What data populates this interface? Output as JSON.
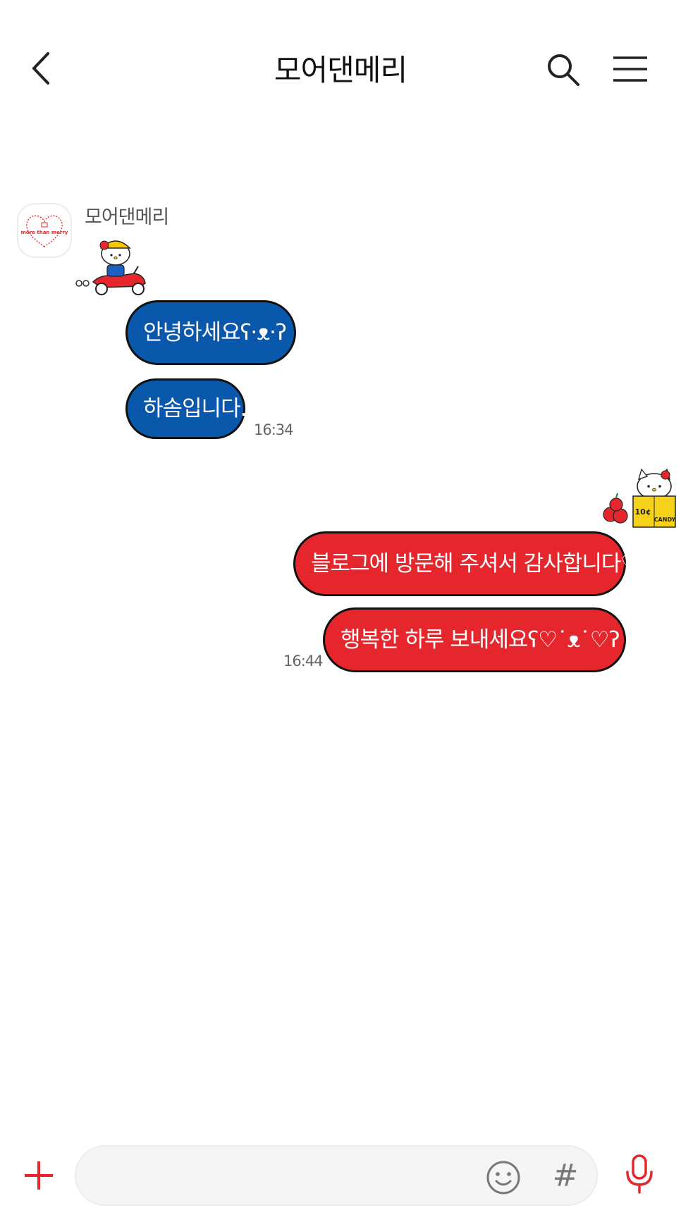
{
  "header": {
    "title": "모어댄메리",
    "back_icon": "chevron-left-icon",
    "search_icon": "search-icon",
    "menu_icon": "hamburger-menu-icon"
  },
  "messages": {
    "sender_name": "모어댄메리",
    "avatar_logo_text": "more than merry",
    "incoming": [
      {
        "text": "안녕하세요ʕ·ᴥ·ʔ"
      },
      {
        "text": "하솜입니다."
      }
    ],
    "incoming_time": "16:34",
    "outgoing": [
      {
        "text": "블로그에 방문해 주셔서 감사합니다♡"
      },
      {
        "text": "행복한 하루 보내세요ʕ♡˙ᴥ˙♡ʔ"
      }
    ],
    "outgoing_time": "16:44",
    "sticker_in": "hello-kitty-scooter-sticker",
    "sticker_out": "hello-kitty-candy-bag-sticker",
    "sticker_out_text": [
      "10¢",
      "CANDY"
    ]
  },
  "composer": {
    "placeholder": "",
    "value": "",
    "plus_icon": "plus-icon",
    "emoji_icon": "emoji-icon",
    "hashtag_label": "#",
    "mic_icon": "microphone-icon"
  },
  "colors": {
    "incoming_bubble": "#0a58ac",
    "outgoing_bubble": "#e5272d",
    "accent": "#e5272d"
  }
}
